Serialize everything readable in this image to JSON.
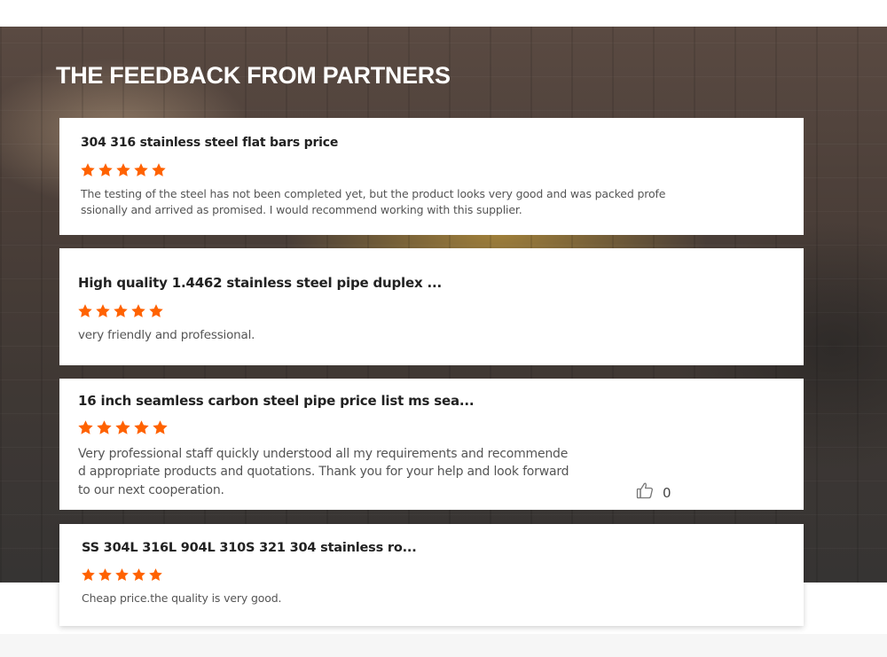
{
  "section": {
    "title": "THE FEEDBACK FROM PARTNERS"
  },
  "colors": {
    "star": "#ff6200",
    "title_text": "#ffffff",
    "card_bg": "#ffffff"
  },
  "icons": {
    "star": "star-icon",
    "like": "thumbs-up-icon"
  },
  "reviews": [
    {
      "product": "304 316 stainless steel flat bars price",
      "rating": 5,
      "text_line1": "The testing of the steel has not been completed yet, but the product looks very good and was packed profe",
      "text_line2": "ssionally and arrived as promised. I would recommend working with this supplier."
    },
    {
      "product": "High quality 1.4462 stainless steel pipe duplex ...",
      "rating": 5,
      "text_line1": "very friendly and professional."
    },
    {
      "product": "16 inch seamless carbon steel pipe price list ms sea...",
      "rating": 5,
      "text_line1": "Very professional staff quickly understood all my requirements and recommende",
      "text_line2": "d appropriate products and quotations. Thank you for your help and look forward",
      "text_line3": "to our next cooperation.",
      "likes": "0"
    },
    {
      "product": "SS 304L 316L 904L 310S 321 304 stainless ro...",
      "rating": 5,
      "text_line1": "Cheap price.the quality is very good."
    }
  ]
}
